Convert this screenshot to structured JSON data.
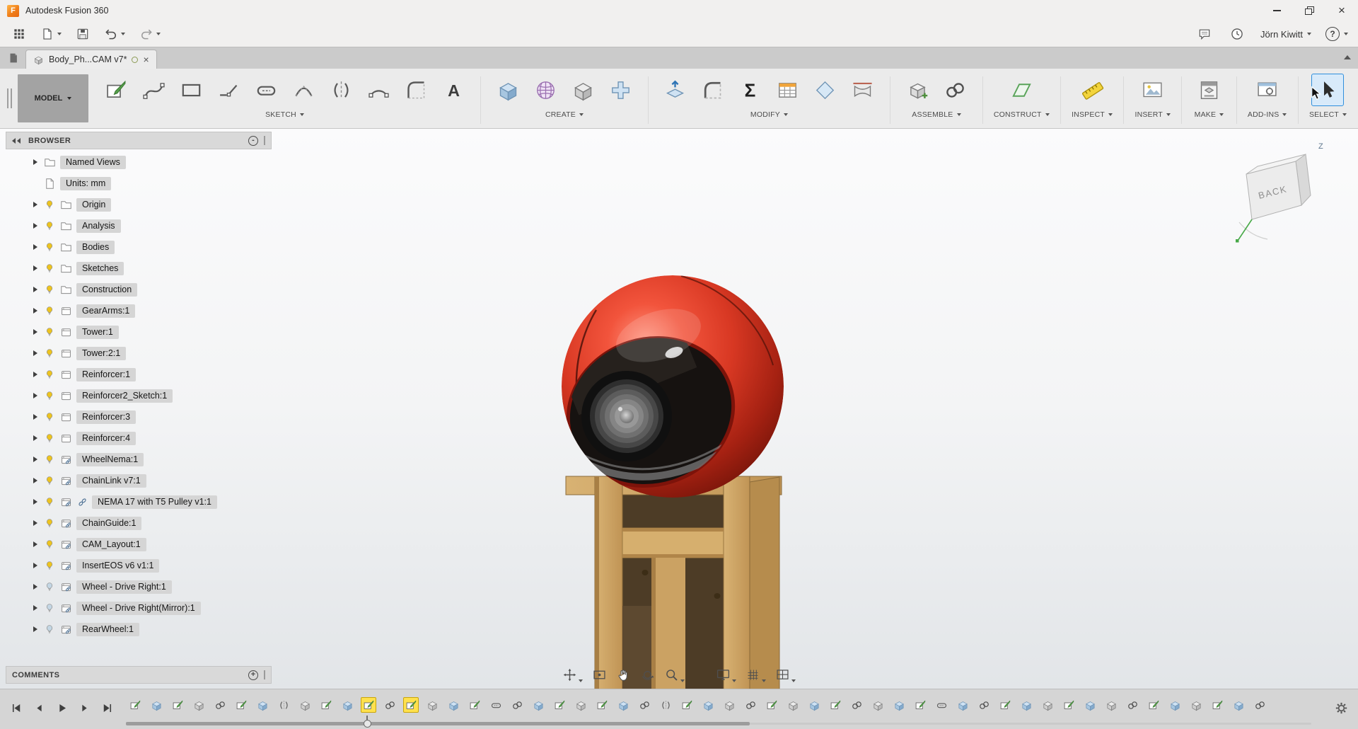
{
  "colors": {
    "select_accent": "#2f8fdd",
    "timeline_highlight": "#ffe14d",
    "bulb_on": "#edc41f",
    "bulb_off": "#c3d6e4"
  },
  "window": {
    "logo_letter": "F",
    "title": "Autodesk Fusion 360"
  },
  "quick_access": {
    "user": "Jörn Kiwitt",
    "help_label": "?"
  },
  "document_tabs": {
    "active": {
      "label": "Body_Ph...CAM v7*"
    }
  },
  "ribbon": {
    "workspace": "MODEL",
    "groups": [
      {
        "label": "SKETCH",
        "tools": [
          "sketch-create",
          "spline",
          "rectangle",
          "line",
          "slot",
          "conic",
          "mirror",
          "arc",
          "fillet-arc",
          "text-a"
        ]
      },
      {
        "label": "CREATE",
        "tools": [
          "extrude",
          "form",
          "box",
          "pipe"
        ]
      },
      {
        "label": "MODIFY",
        "tools": [
          "press-pull",
          "fillet",
          "sigma",
          "params-table",
          "section",
          "split"
        ]
      },
      {
        "label": "ASSEMBLE",
        "tools": [
          "new-component",
          "joint"
        ]
      },
      {
        "label": "CONSTRUCT",
        "tools": [
          "plane"
        ]
      },
      {
        "label": "INSPECT",
        "tools": [
          "measure"
        ]
      },
      {
        "label": "INSERT",
        "tools": [
          "canvas-image"
        ]
      },
      {
        "label": "MAKE",
        "tools": [
          "print3d"
        ]
      },
      {
        "label": "ADD-INS",
        "tools": [
          "scripts"
        ]
      },
      {
        "label": "SELECT",
        "tools": [
          "cursor"
        ]
      }
    ]
  },
  "browser": {
    "title": "BROWSER",
    "items": [
      {
        "label": "Named Views",
        "icon": "folder",
        "bulb": null,
        "arrow": true
      },
      {
        "label": "Units: mm",
        "icon": "document",
        "bulb": null,
        "arrow": false
      },
      {
        "label": "Origin",
        "icon": "folder",
        "bulb": "on",
        "arrow": true
      },
      {
        "label": "Analysis",
        "icon": "folder",
        "bulb": "on",
        "arrow": true
      },
      {
        "label": "Bodies",
        "icon": "folder",
        "bulb": "on",
        "arrow": true
      },
      {
        "label": "Sketches",
        "icon": "folder",
        "bulb": "on",
        "arrow": true
      },
      {
        "label": "Construction",
        "icon": "folder",
        "bulb": "on",
        "arrow": true
      },
      {
        "label": "GearArms:1",
        "icon": "component",
        "bulb": "on",
        "arrow": true
      },
      {
        "label": "Tower:1",
        "icon": "component",
        "bulb": "on",
        "arrow": true
      },
      {
        "label": "Tower:2:1",
        "icon": "component",
        "bulb": "on",
        "arrow": true
      },
      {
        "label": "Reinforcer:1",
        "icon": "component",
        "bulb": "on",
        "arrow": true
      },
      {
        "label": "Reinforcer2_Sketch:1",
        "icon": "component",
        "bulb": "on",
        "arrow": true
      },
      {
        "label": "Reinforcer:3",
        "icon": "component",
        "bulb": "on",
        "arrow": true
      },
      {
        "label": "Reinforcer:4",
        "icon": "component",
        "bulb": "on",
        "arrow": true
      },
      {
        "label": "WheelNema:1",
        "icon": "component-linked",
        "bulb": "on",
        "arrow": true
      },
      {
        "label": "ChainLink v7:1",
        "icon": "component-linked",
        "bulb": "on",
        "arrow": true
      },
      {
        "label": "NEMA 17 with T5 Pulley v1:1",
        "icon": "component-linked",
        "bulb": "on",
        "arrow": true,
        "link": true
      },
      {
        "label": "ChainGuide:1",
        "icon": "component-linked",
        "bulb": "on",
        "arrow": true
      },
      {
        "label": "CAM_Layout:1",
        "icon": "component-linked",
        "bulb": "on",
        "arrow": true
      },
      {
        "label": "InsertEOS v6 v1:1",
        "icon": "component-linked",
        "bulb": "on",
        "arrow": true
      },
      {
        "label": "Wheel - Drive Right:1",
        "icon": "component-linked",
        "bulb": "off",
        "arrow": true
      },
      {
        "label": "Wheel - Drive Right(Mirror):1",
        "icon": "component-linked",
        "bulb": "off",
        "arrow": true
      },
      {
        "label": "RearWheel:1",
        "icon": "component-linked",
        "bulb": "off",
        "arrow": true
      }
    ]
  },
  "comments": {
    "title": "COMMENTS"
  },
  "viewcube": {
    "face": "BACK",
    "axis": "Z"
  },
  "navbar": {
    "buttons": [
      {
        "name": "orbit-pan",
        "caret": true
      },
      {
        "name": "look-at",
        "caret": false
      },
      {
        "name": "pan",
        "caret": false
      },
      {
        "name": "orbit",
        "caret": false
      },
      {
        "name": "zoom",
        "caret": true
      },
      {
        "name": "display-settings",
        "caret": true,
        "gap_before": true
      },
      {
        "name": "grid-snaps",
        "caret": true
      },
      {
        "name": "viewports",
        "caret": true
      }
    ]
  },
  "timeline": {
    "playback": [
      "skip-start",
      "step-back",
      "play",
      "step-forward",
      "skip-end"
    ],
    "features": [
      "sketch",
      "extrude",
      "sketch",
      "box",
      "joint",
      "sketch",
      "extrude",
      "mirror",
      "box",
      "sketch",
      "extrude",
      "sketch",
      "joint",
      "sketch",
      "box",
      "extrude",
      "sketch",
      "hole",
      "joint",
      "extrude",
      "sketch",
      "box",
      "sketch",
      "extrude",
      "joint",
      "mirror",
      "sketch",
      "extrude",
      "box",
      "joint",
      "sketch",
      "box",
      "extrude",
      "sketch",
      "joint",
      "box",
      "extrude",
      "sketch",
      "hole",
      "extrude",
      "joint",
      "sketch",
      "extrude",
      "box",
      "sketch",
      "extrude",
      "box",
      "joint",
      "sketch",
      "extrude",
      "box",
      "sketch",
      "extrude",
      "joint"
    ],
    "highlighted": [
      11,
      13
    ]
  }
}
